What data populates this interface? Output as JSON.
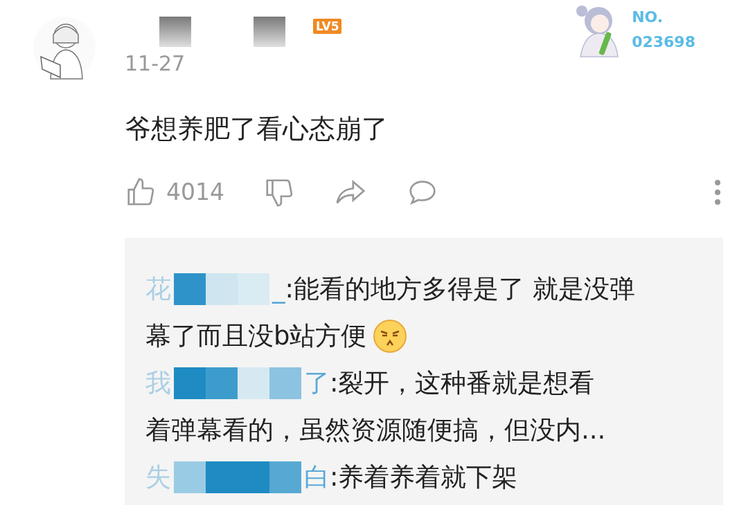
{
  "comment": {
    "level_badge": "LV5",
    "date": "11-27",
    "text": "爷想养肥了看心态崩了",
    "likes": "4014"
  },
  "fan_badge": {
    "label": "NO.",
    "number": "023698"
  },
  "replies": [
    {
      "name_start": "花",
      "name_end": "_",
      "separator": ":",
      "text_lines": [
        "能看的地方多得是了 就是没弹",
        "幕了而且没b站方便"
      ],
      "emoji": true
    },
    {
      "name_start": "我",
      "name_end": "了",
      "separator": ":",
      "text_lines": [
        "裂开，这种番就是想看",
        "着弹幕看的，虽然资源随便搞，但没内..."
      ],
      "emoji": false
    },
    {
      "name_start": "失",
      "name_end": "白",
      "separator": ":",
      "text_lines": [
        "养着养着就下架"
      ],
      "emoji": false
    }
  ]
}
